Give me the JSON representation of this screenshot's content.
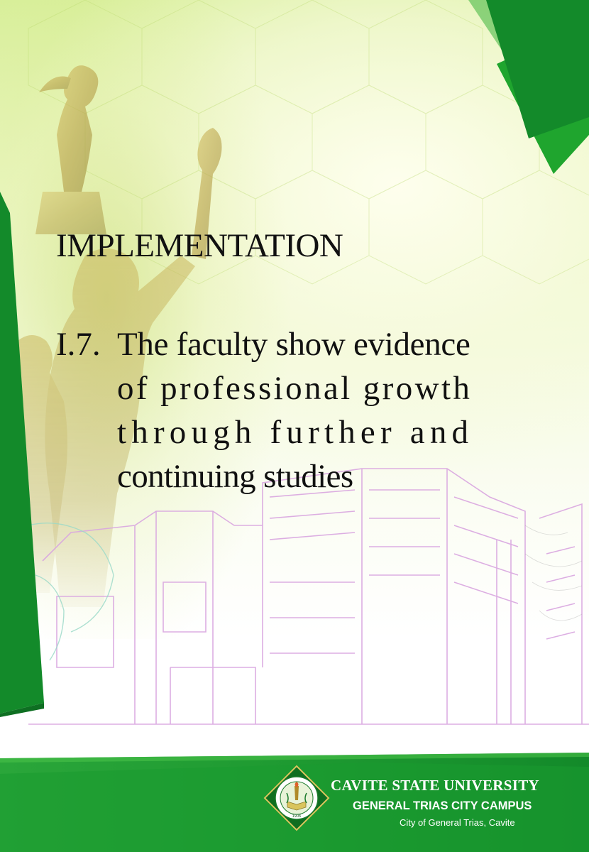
{
  "document": {
    "heading": "IMPLEMENTATION",
    "item": {
      "number": "I.7.",
      "lines": [
        "The faculty show evidence",
        "of professional growth",
        "through further and",
        "continuing studies"
      ]
    }
  },
  "footer": {
    "university": "CAVITE STATE UNIVERSITY",
    "campus": "GENERAL TRIAS CITY CAMPUS",
    "location": "City of General Trias, Cavite",
    "seal_year": "1906"
  },
  "colors": {
    "green_dark": "#138a2a",
    "green_bright": "#3cb53c",
    "lime": "#c9e27a",
    "text": "#111111"
  },
  "icons": {
    "seal": "university-seal-icon",
    "statue": "monument-statue-illustration",
    "building": "campus-building-outline-illustration"
  }
}
